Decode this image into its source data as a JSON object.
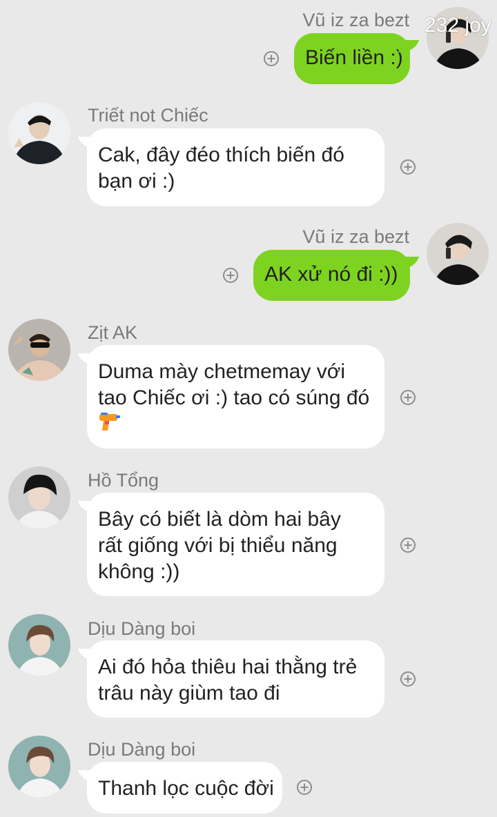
{
  "watermark": "232 joy",
  "messages": [
    {
      "sender": "Vũ iz za bezt",
      "direction": "outgoing",
      "avatar_icon": "person-phone-avatar",
      "lines": [
        "Biến liền :)"
      ]
    },
    {
      "sender": "Triết not Chiếc",
      "direction": "incoming",
      "avatar_icon": "person-hoodie-avatar",
      "lines": [
        "Cak, đây đéo thích biến đó",
        "bạn ơi :)"
      ]
    },
    {
      "sender": "Vũ iz za bezt",
      "direction": "outgoing",
      "avatar_icon": "person-phone-avatar",
      "lines": [
        "AK xử nó đi :))"
      ]
    },
    {
      "sender": "Zịt AK",
      "direction": "incoming",
      "avatar_icon": "person-sunglasses-avatar",
      "lines": [
        "Duma mày chetmemay với",
        "tao Chiếc ơi :) tao có súng đó"
      ],
      "emoji": "water-pistol"
    },
    {
      "sender": "Hồ Tổng",
      "direction": "incoming",
      "avatar_icon": "person-dark-hair-avatar",
      "lines": [
        "Bây có biết là dòm hai bây",
        "rất giống với bị thiểu năng",
        "không :))"
      ]
    },
    {
      "sender": "Dịu Dàng boi",
      "direction": "incoming",
      "avatar_icon": "person-teal-bg-avatar",
      "lines": [
        "Ai đó hỏa thiêu hai thằng trẻ",
        "trâu này giùm tao đi"
      ]
    },
    {
      "sender": "Dịu Dàng boi",
      "direction": "incoming",
      "avatar_icon": "person-teal-bg-avatar",
      "lines": [
        "Thanh lọc cuộc đời"
      ]
    }
  ],
  "colors": {
    "background": "#e9e9e9",
    "outgoing_bubble": "#7ed321",
    "incoming_bubble": "#ffffff",
    "sender_name": "#7a7a7a",
    "message_text": "#222222"
  }
}
